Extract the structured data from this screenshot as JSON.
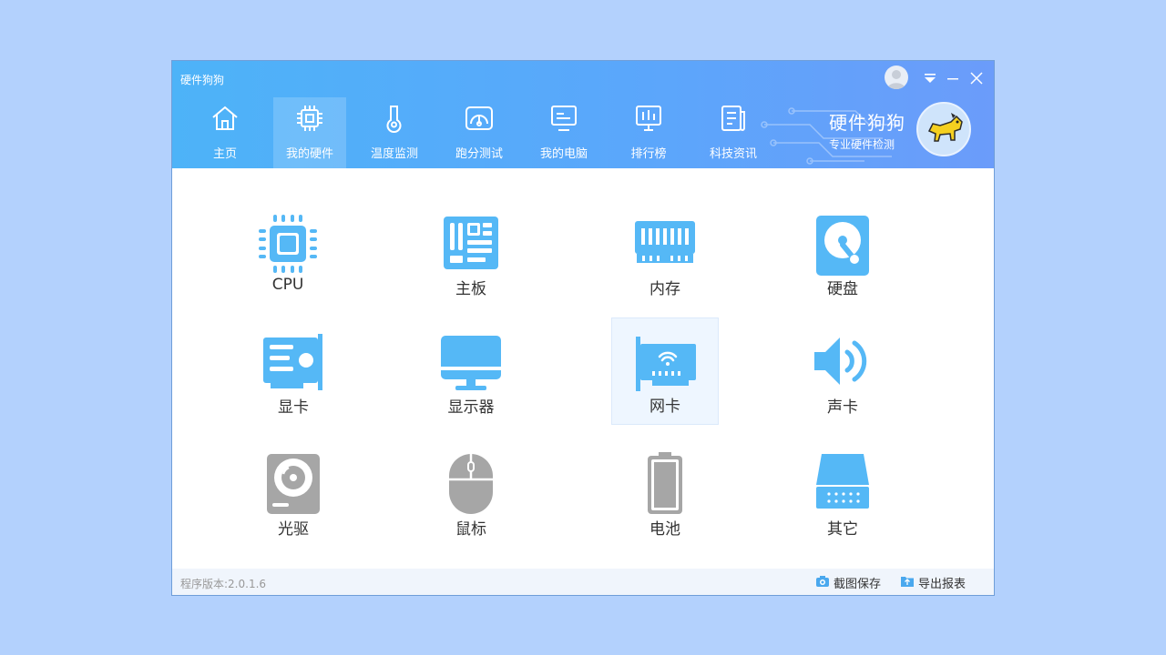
{
  "window": {
    "title": "硬件狗狗",
    "controls": [
      "avatar-icon",
      "dropdown-icon",
      "minimize-icon",
      "close-icon"
    ]
  },
  "nav": {
    "tabs": [
      {
        "label": "主页",
        "icon": "home-icon"
      },
      {
        "label": "我的硬件",
        "icon": "chip-icon",
        "active": true
      },
      {
        "label": "温度监测",
        "icon": "thermometer-icon"
      },
      {
        "label": "跑分测试",
        "icon": "speedometer-icon"
      },
      {
        "label": "我的电脑",
        "icon": "computer-icon"
      },
      {
        "label": "排行榜",
        "icon": "ranking-icon"
      },
      {
        "label": "科技资讯",
        "icon": "news-icon"
      }
    ]
  },
  "brand": {
    "title": "硬件狗狗",
    "subtitle": "专业硬件检测",
    "logo": "dog-logo"
  },
  "hardware": {
    "items": [
      {
        "label": "CPU",
        "icon": "cpu-icon"
      },
      {
        "label": "主板",
        "icon": "motherboard-icon"
      },
      {
        "label": "内存",
        "icon": "memory-icon"
      },
      {
        "label": "硬盘",
        "icon": "harddisk-icon"
      },
      {
        "label": "显卡",
        "icon": "graphics-card-icon"
      },
      {
        "label": "显示器",
        "icon": "monitor-icon"
      },
      {
        "label": "网卡",
        "icon": "network-card-icon"
      },
      {
        "label": "声卡",
        "icon": "sound-card-icon"
      },
      {
        "label": "光驱",
        "icon": "optical-drive-icon"
      },
      {
        "label": "鼠标",
        "icon": "mouse-icon"
      },
      {
        "label": "电池",
        "icon": "battery-icon"
      },
      {
        "label": "其它",
        "icon": "other-device-icon"
      }
    ]
  },
  "footer": {
    "version": "程序版本:2.0.1.6",
    "screenshot_label": "截图保存",
    "export_label": "导出报表"
  },
  "colors": {
    "accent": "#4db3f8",
    "icon_blue": "#55b8f6",
    "icon_gray": "#a6a6a6"
  }
}
